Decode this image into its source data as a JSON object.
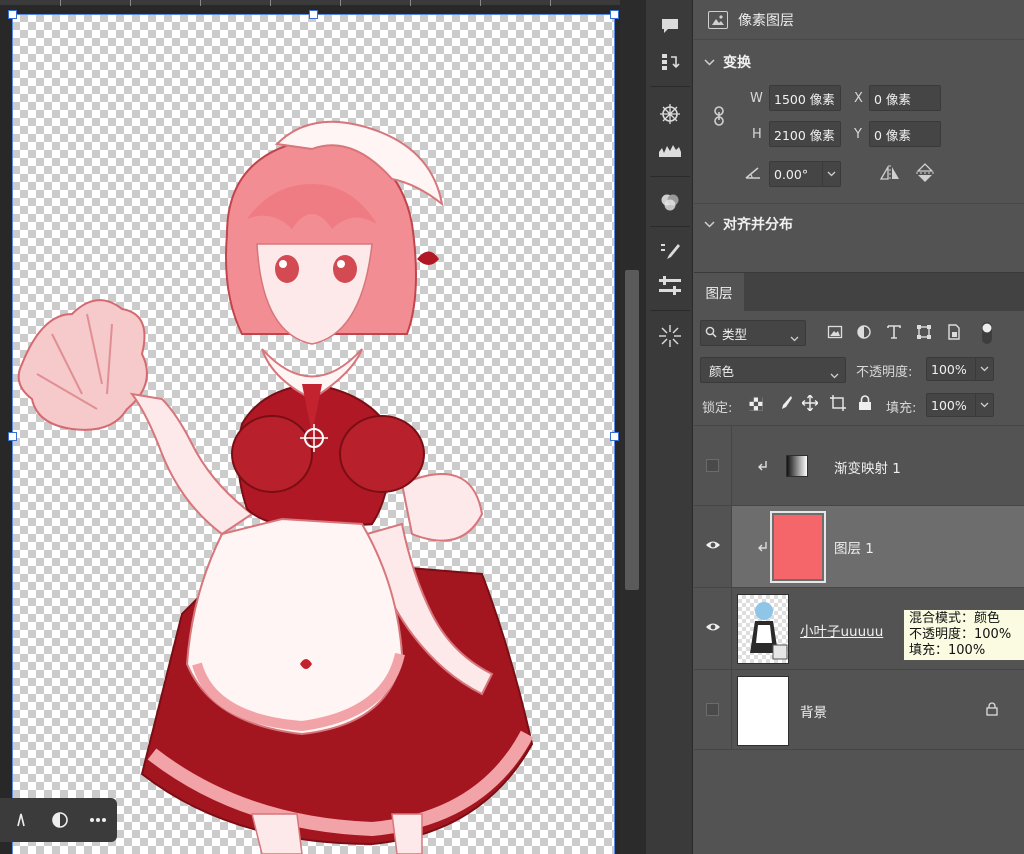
{
  "properties": {
    "header_title": "像素图层",
    "transform_title": "变换",
    "w_label": "W",
    "w_value": "1500 像素",
    "x_label": "X",
    "x_value": "0 像素",
    "h_label": "H",
    "h_value": "2100 像素",
    "y_label": "Y",
    "y_value": "0 像素",
    "angle_value": "0.00°",
    "align_title": "对齐并分布"
  },
  "layers_panel": {
    "tab_label": "图层",
    "filter_kind": "类型",
    "blend_mode": "颜色",
    "opacity_label": "不透明度:",
    "opacity_value": "100%",
    "lock_label": "锁定:",
    "fill_label": "填充:",
    "fill_value": "100%",
    "layers": [
      {
        "name": "渐变映射 1",
        "visible": false,
        "clipped": true,
        "kind": "gradient-map"
      },
      {
        "name": "图层 1",
        "visible": true,
        "clipped": true,
        "kind": "color-fill",
        "color": "#f4666a",
        "selected": true
      },
      {
        "name": "小叶子uuuuu",
        "visible": true,
        "clipped": false,
        "kind": "smart-object"
      },
      {
        "name": "背景",
        "visible": false,
        "clipped": false,
        "kind": "background",
        "locked": true
      }
    ],
    "tooltip": [
      "混合模式：颜色",
      "不透明度：100%",
      "填充：100%"
    ]
  },
  "colors": {
    "panel_bg": "#535353",
    "dark_bg": "#282828",
    "accent_red": "#f4666a",
    "selection_blue": "#3b6fd0"
  }
}
